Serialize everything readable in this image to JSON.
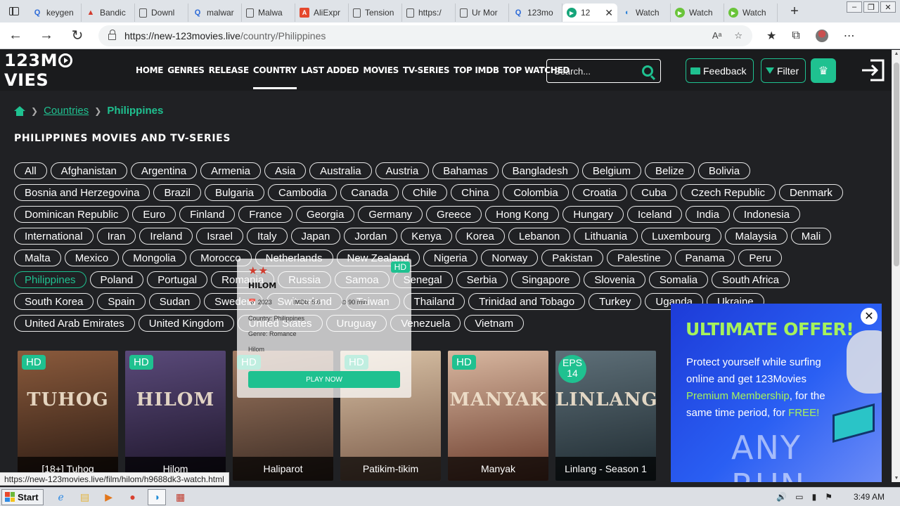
{
  "browser": {
    "tabs": [
      {
        "label": "keygen",
        "icon": "search-icon"
      },
      {
        "label": "Bandic",
        "icon": "bandicam-icon"
      },
      {
        "label": "Downl",
        "icon": "document-icon"
      },
      {
        "label": "malwar",
        "icon": "search-icon"
      },
      {
        "label": "Malwa",
        "icon": "document-icon"
      },
      {
        "label": "AliExpr",
        "icon": "aliexpress-icon"
      },
      {
        "label": "Tension",
        "icon": "document-icon"
      },
      {
        "label": "https:/",
        "icon": "document-icon"
      },
      {
        "label": "Ur Mor",
        "icon": "document-icon"
      },
      {
        "label": "123mo",
        "icon": "search-icon"
      },
      {
        "label": "12",
        "icon": "play-icon",
        "active": true
      },
      {
        "label": "Watch",
        "icon": "drop-icon"
      },
      {
        "label": "Watch",
        "icon": "green-play-icon"
      },
      {
        "label": "Watch",
        "icon": "green-play-icon"
      }
    ],
    "url_host": "https://new-123movies.live",
    "url_path": "/country/Philippines"
  },
  "site": {
    "logo": "123MOVIES",
    "nav": [
      "HOME",
      "GENRES",
      "RELEASE",
      "COUNTRY",
      "LAST ADDED",
      "MOVIES",
      "TV-SERIES",
      "TOP IMDB",
      "TOP WATCHED"
    ],
    "nav_active": "COUNTRY",
    "search_placeholder": "Search...",
    "feedback_label": "Feedback",
    "filter_label": "Filter",
    "breadcrumb": {
      "link": "Countries",
      "current": "Philippines"
    },
    "page_title": "PHILIPPINES MOVIES AND TV-SERIES",
    "countries": [
      "All",
      "Afghanistan",
      "Argentina",
      "Armenia",
      "Asia",
      "Australia",
      "Austria",
      "Bahamas",
      "Bangladesh",
      "Belgium",
      "Belize",
      "Bolivia",
      "Bosnia and Herzegovina",
      "Brazil",
      "Bulgaria",
      "Cambodia",
      "Canada",
      "Chile",
      "China",
      "Colombia",
      "Croatia",
      "Cuba",
      "Czech Republic",
      "Denmark",
      "Dominican Republic",
      "Euro",
      "Finland",
      "France",
      "Georgia",
      "Germany",
      "Greece",
      "Hong Kong",
      "Hungary",
      "Iceland",
      "India",
      "Indonesia",
      "International",
      "Iran",
      "Ireland",
      "Israel",
      "Italy",
      "Japan",
      "Jordan",
      "Kenya",
      "Korea",
      "Lebanon",
      "Lithuania",
      "Luxembourg",
      "Malaysia",
      "Mali",
      "Malta",
      "Mexico",
      "Mongolia",
      "Morocco",
      "Netherlands",
      "New Zealand",
      "Nigeria",
      "Norway",
      "Pakistan",
      "Palestine",
      "Panama",
      "Peru",
      "Philippines",
      "Poland",
      "Portugal",
      "Romania",
      "Russia",
      "Samoa",
      "Senegal",
      "Serbia",
      "Singapore",
      "Slovenia",
      "Somalia",
      "South Africa",
      "South Korea",
      "Spain",
      "Sudan",
      "Sweden",
      "Switzerland",
      "Taiwan",
      "Thailand",
      "Trinidad and Tobago",
      "Turkey",
      "Uganda",
      "Ukraine",
      "United Arab Emirates",
      "United Kingdom",
      "United States",
      "Uruguay",
      "Venezuela",
      "Vietnam"
    ],
    "active_country": "Philippines",
    "movies": [
      {
        "title": "[18+] Tuhog",
        "badge": "HD",
        "overlay": "TUHOG",
        "colors": [
          "#8a5a3c",
          "#2a1a12"
        ]
      },
      {
        "title": "Hilom",
        "badge": "HD",
        "overlay": "HILOM",
        "colors": [
          "#5a4a7a",
          "#1c1428"
        ]
      },
      {
        "title": "Haliparot",
        "badge": "HD",
        "overlay": "",
        "colors": [
          "#a07a62",
          "#3a2a22"
        ]
      },
      {
        "title": "Patikim-tikim",
        "badge": "HD",
        "overlay": "",
        "colors": [
          "#d9c2a6",
          "#7a5a48"
        ]
      },
      {
        "title": "Manyak",
        "badge": "HD",
        "overlay": "MANYAK",
        "colors": [
          "#d8b7a0",
          "#6a3a2a"
        ]
      },
      {
        "title": "Linlang - Season 1",
        "badge": "EPS 14",
        "overlay": "LINLANG",
        "colors": [
          "#5e6f78",
          "#1e2a30"
        ]
      }
    ],
    "hover_card": {
      "stars": "★★",
      "badge": "HD",
      "title": "HILOM",
      "year": "2023",
      "imdb": "IMDb: 5.6",
      "duration": "90 min",
      "country": "Country: Philippines",
      "genre": "Genre: Romance",
      "desc": "Hilom",
      "play": "PLAY NOW"
    }
  },
  "ad": {
    "title": "ULTIMATE OFFER!",
    "line1": "Protect yourself while surfing online and get 123Movies ",
    "accent1": "Premium Membership",
    "line2": ", for the same time period, for ",
    "accent2": "FREE!",
    "watermark": "ANY RUN"
  },
  "status_url": "https://new-123movies.live/film/hilom/h9688dk3-watch.html",
  "taskbar": {
    "start": "Start",
    "clock": "3:49 AM"
  },
  "colors": {
    "accent": "#1fc190",
    "header_bg": "#1a1b1d",
    "page_bg": "#202124",
    "ad_bg": "#2a5ff3"
  }
}
